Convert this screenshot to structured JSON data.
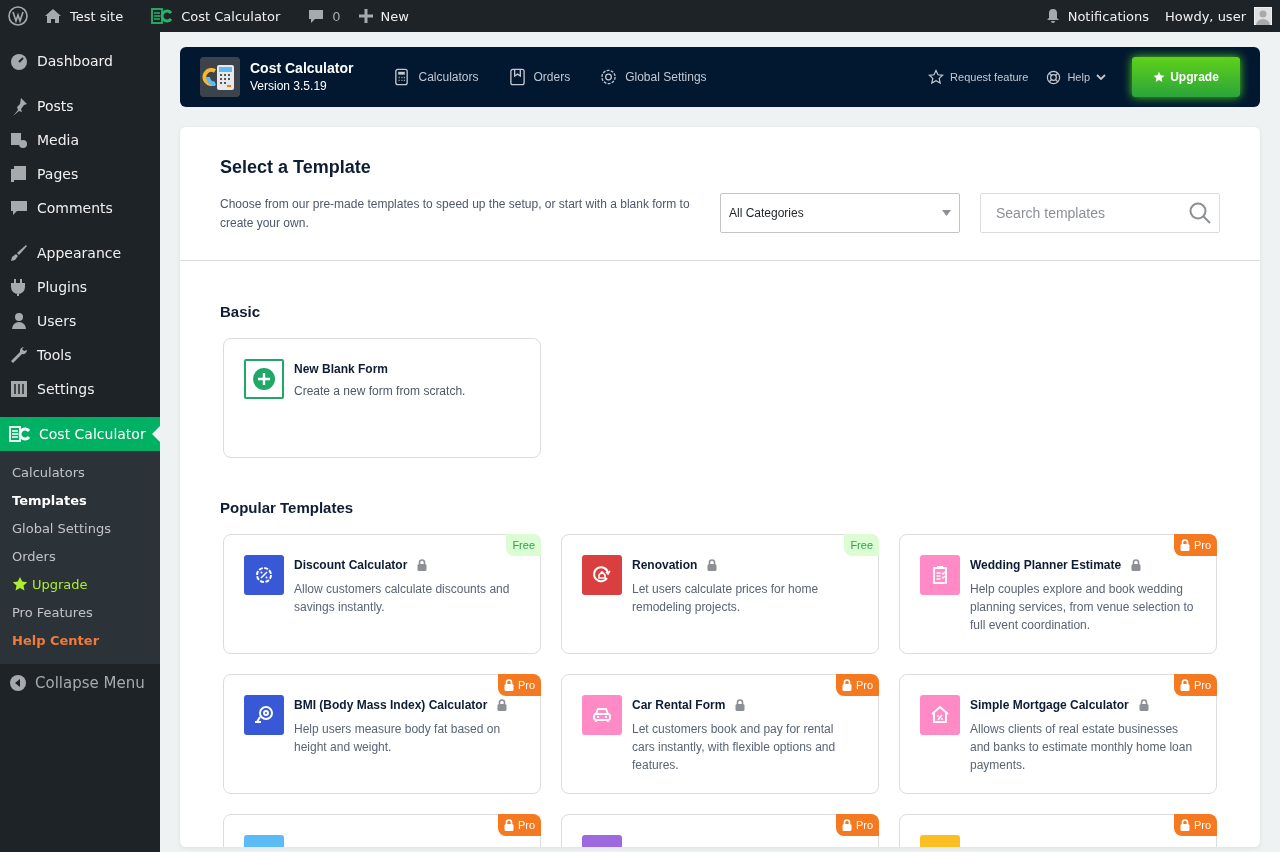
{
  "admin_bar": {
    "site": "Test site",
    "plugin": "Cost Calculator",
    "comments": "0",
    "new": "New",
    "notifications": "Notifications",
    "greeting": "Howdy, user"
  },
  "sidebar": {
    "items": [
      {
        "label": "Dashboard",
        "selected": false
      },
      {
        "label": "Posts",
        "selected": false
      },
      {
        "label": "Media",
        "selected": false
      },
      {
        "label": "Pages",
        "selected": false
      },
      {
        "label": "Comments",
        "selected": false
      },
      {
        "label": "Appearance",
        "selected": false
      },
      {
        "label": "Plugins",
        "selected": false
      },
      {
        "label": "Users",
        "selected": false
      },
      {
        "label": "Tools",
        "selected": false
      },
      {
        "label": "Settings",
        "selected": false
      },
      {
        "label": "Cost Calculator",
        "selected": true
      }
    ],
    "submenu": [
      {
        "label": "Calculators",
        "kind": "normal",
        "selected": false
      },
      {
        "label": "Templates",
        "kind": "normal",
        "selected": true
      },
      {
        "label": "Global Settings",
        "kind": "normal",
        "selected": false
      },
      {
        "label": "Orders",
        "kind": "normal",
        "selected": false
      },
      {
        "label": "Upgrade",
        "kind": "upgrade",
        "selected": false
      },
      {
        "label": "Pro Features",
        "kind": "normal",
        "selected": false
      },
      {
        "label": "Help Center",
        "kind": "help",
        "selected": false
      }
    ],
    "collapse": "Collapse Menu"
  },
  "plugin_header": {
    "name": "Cost Calculator",
    "version": "Version 3.5.19",
    "nav": [
      "Calculators",
      "Orders",
      "Global Settings"
    ],
    "request_feature": "Request feature",
    "help": "Help",
    "upgrade": "Upgrade"
  },
  "templates": {
    "title": "Select a Template",
    "description": "Choose from our pre-made templates to speed up the setup, or start with a blank form to create your own.",
    "category": "All Categories",
    "search": {
      "placeholder": "Search templates"
    },
    "basic": {
      "heading": "Basic",
      "blank": {
        "title": "New Blank Form",
        "description": "Create a new form from scratch."
      }
    },
    "popular": {
      "heading": "Popular Templates",
      "cards": [
        {
          "title": "Discount Calculator",
          "description": "Allow customers calculate discounts and savings instantly.",
          "badge": "Free",
          "kind": "free",
          "color": "#3858d6"
        },
        {
          "title": "Renovation",
          "description": "Let users calculate prices for home remodeling projects.",
          "badge": "Free",
          "kind": "free",
          "color": "#d93f3f"
        },
        {
          "title": "Wedding Planner Estimate",
          "description": "Help couples explore and book wedding planning services, from venue selection to full event coordination.",
          "badge": "Pro",
          "kind": "pro",
          "color": "#ff8ac5"
        },
        {
          "title": "BMI (Body Mass Index) Calculator",
          "description": "Help users measure body fat based on height and weight.",
          "badge": "Pro",
          "kind": "pro",
          "color": "#3858d6"
        },
        {
          "title": "Car Rental Form",
          "description": "Let customers book and pay for rental cars instantly, with flexible options and features.",
          "badge": "Pro",
          "kind": "pro",
          "color": "#ff8ac5"
        },
        {
          "title": "Simple Mortgage Calculator",
          "description": "Allows clients of real estate businesses and banks to estimate monthly home loan payments.",
          "badge": "Pro",
          "kind": "pro",
          "color": "#ff8ac5"
        },
        {
          "badge": "Pro",
          "kind": "pro",
          "color": "#5bbcf5"
        },
        {
          "badge": "Pro",
          "kind": "pro",
          "color": "#9c6ade"
        },
        {
          "badge": "Pro",
          "kind": "pro",
          "color": "#fbbf24"
        }
      ]
    }
  }
}
